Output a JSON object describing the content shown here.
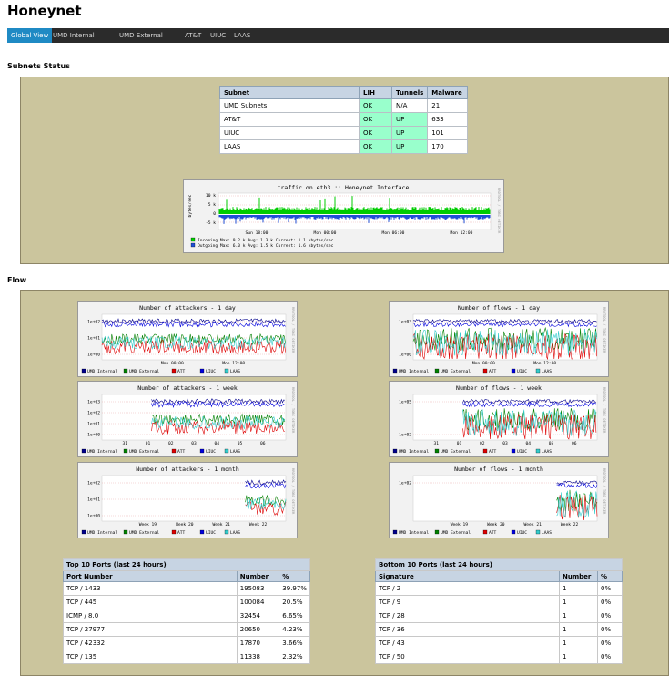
{
  "page": {
    "title": "Honeynet"
  },
  "nav": {
    "tabs": [
      "Global View",
      "UMD Internal",
      "UMD External",
      "AT&T",
      "UIUC",
      "LAAS"
    ],
    "active": 0
  },
  "sections": {
    "subnets": "Subnets Status",
    "flow": "Flow"
  },
  "status_table": {
    "headers": [
      "Subnet",
      "LIH",
      "Tunnels",
      "Malware"
    ],
    "rows": [
      [
        "UMD Subnets",
        "OK",
        "N/A",
        "21"
      ],
      [
        "AT&T",
        "OK",
        "UP",
        "633"
      ],
      [
        "UIUC",
        "OK",
        "UP",
        "101"
      ],
      [
        "LAAS",
        "OK",
        "UP",
        "170"
      ]
    ]
  },
  "traffic_graph": {
    "title": "traffic on eth3 :: Honeynet Interface",
    "ylabel": "bytes/sec",
    "yticks": [
      "10 k",
      "5 k",
      "0",
      "-5 k"
    ],
    "xticks": [
      "Sun 18:00",
      "Mon 00:00",
      "Mon 06:00",
      "Mon 12:00"
    ],
    "legend1": "Incoming   Max:   9.2 k   Avg:   1.3 k   Current:   1.1 kbytes/sec",
    "legend2": "Outgoing       Max:   6.0 k         Avg:   1.5 k         Current:   1.6 kbytes/sec",
    "side": "RRDTOOL / TOBI OETIKER",
    "colors": {
      "incoming": "#00cc00",
      "outgoing": "#1f4fd6"
    }
  },
  "legend_items": [
    {
      "label": "UMD Internal",
      "color": "#00008b"
    },
    {
      "label": "UMD External",
      "color": "#008000"
    },
    {
      "label": "ATT",
      "color": "#dd0000"
    },
    {
      "label": "UIUC",
      "color": "#0000dd"
    },
    {
      "label": "LAAS",
      "color": "#33cccc"
    }
  ],
  "flow_graphs": [
    {
      "title": "Number of attackers - 1 day",
      "yticks": [
        "1e+02",
        "1e+01",
        "1e+00"
      ],
      "xticks": [
        "Mon 00:00",
        "Mon 12:00"
      ]
    },
    {
      "title": "Number of flows - 1 day",
      "yticks": [
        "1e+03",
        "1e+00"
      ],
      "xticks": [
        "Mon 00:00",
        "Mon 12:00"
      ]
    },
    {
      "title": "Number of attackers - 1 week",
      "yticks": [
        "1e+03",
        "1e+02",
        "1e+01",
        "1e+00"
      ],
      "xticks": [
        "31",
        "01",
        "02",
        "03",
        "04",
        "05",
        "06"
      ]
    },
    {
      "title": "Number of flows - 1 week",
      "yticks": [
        "1e+05",
        "1e+02"
      ],
      "xticks": [
        "31",
        "01",
        "02",
        "03",
        "04",
        "05",
        "06"
      ]
    },
    {
      "title": "Number of attackers - 1 month",
      "yticks": [
        "1e+02",
        "1e+01",
        "1e+00"
      ],
      "xticks": [
        "Week 19",
        "Week 20",
        "Week 21",
        "Week 22"
      ]
    },
    {
      "title": "Number of flows - 1 month",
      "yticks": [
        "1e+02"
      ],
      "xticks": [
        "Week 19",
        "Week 20",
        "Week 21",
        "Week 22"
      ]
    }
  ],
  "top_ports": {
    "caption": "Top 10 Ports (last 24 hours)",
    "headers": [
      "Port Number",
      "Number",
      "%"
    ],
    "rows": [
      [
        "TCP / 1433",
        "195083",
        "39.97%"
      ],
      [
        "TCP / 445",
        "100084",
        "20.5%"
      ],
      [
        "ICMP / 8.0",
        "32454",
        "6.65%"
      ],
      [
        "TCP / 27977",
        "20650",
        "4.23%"
      ],
      [
        "TCP / 42332",
        "17870",
        "3.66%"
      ],
      [
        "TCP / 135",
        "11338",
        "2.32%"
      ]
    ]
  },
  "bottom_ports": {
    "caption": "Bottom 10 Ports (last 24 hours)",
    "headers": [
      "Signature",
      "Number",
      "%"
    ],
    "rows": [
      [
        "TCP / 2",
        "1",
        "0%"
      ],
      [
        "TCP / 9",
        "1",
        "0%"
      ],
      [
        "TCP / 28",
        "1",
        "0%"
      ],
      [
        "TCP / 36",
        "1",
        "0%"
      ],
      [
        "TCP / 43",
        "1",
        "0%"
      ],
      [
        "TCP / 50",
        "1",
        "0%"
      ]
    ]
  }
}
